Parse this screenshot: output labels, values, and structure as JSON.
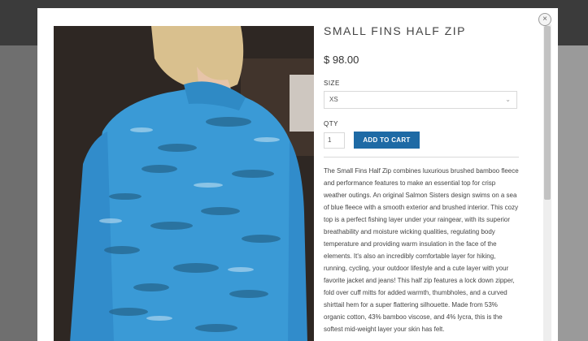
{
  "modal": {
    "close_label": "×"
  },
  "product": {
    "title": "SMALL FINS HALF ZIP",
    "price": "$ 98.00",
    "size_label": "SIZE",
    "size_value": "XS",
    "qty_label": "QTY",
    "qty_value": "1",
    "add_to_cart_label": "ADD TO CART",
    "description": "The Small Fins Half Zip combines luxurious brushed bamboo fleece and performance features to make an essential top for crisp weather outings. An original Salmon Sisters design swims on a sea of blue fleece with a smooth exterior and brushed interior. This cozy top is a perfect fishing layer under your raingear, with its superior breathability and moisture wicking qualities, regulating body temperature and providing warm insulation in the face of the elements. It's also an incredibly comfortable layer for hiking, running, cycling, your outdoor lifestyle and a cute layer with your favorite jacket and jeans! This half zip features a lock down zipper, fold over cuff mitts for added warmth, thumbholes, and a curved shirttail hem for a super flattering silhouette. Made from 53% organic cotton, 43% bamboo viscose, and 4% lycra, this is the softest mid-weight layer your skin has felt."
  },
  "icons": {
    "close": "close-icon",
    "chevron": "chevron-down-icon"
  },
  "colors": {
    "button": "#1e6aa5",
    "shirt": "#3a9ad6"
  }
}
